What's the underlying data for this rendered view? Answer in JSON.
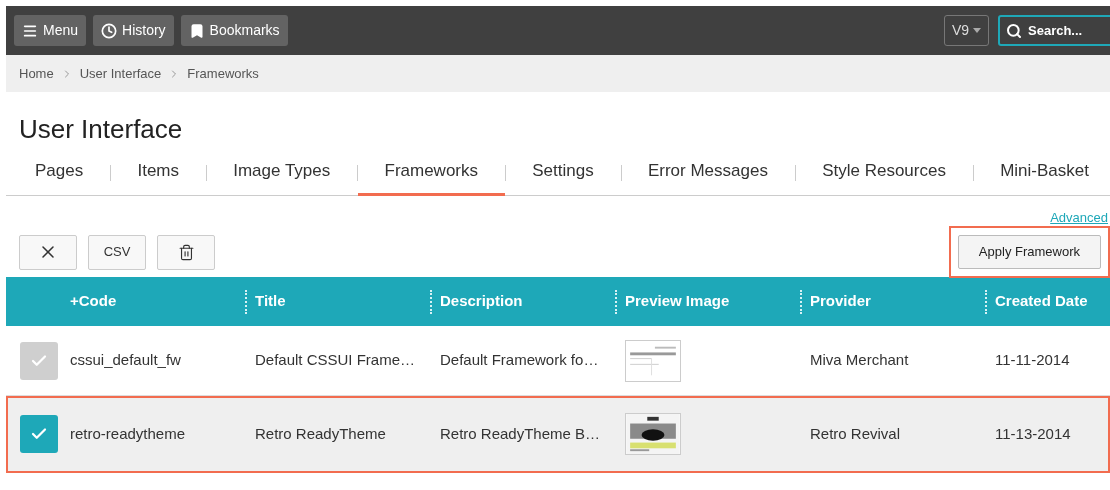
{
  "topbar": {
    "buttons": [
      {
        "kind": "menu",
        "label": "Menu"
      },
      {
        "kind": "history",
        "label": "History"
      },
      {
        "kind": "bookmarks",
        "label": "Bookmarks"
      }
    ],
    "version": "V9",
    "search": {
      "placeholder": "Search..."
    }
  },
  "breadcrumb": [
    "Home",
    "User Interface",
    "Frameworks"
  ],
  "title": "User Interface",
  "tabs": [
    {
      "label": "Pages",
      "selected": false
    },
    {
      "label": "Items",
      "selected": false
    },
    {
      "label": "Image Types",
      "selected": false
    },
    {
      "label": "Frameworks",
      "selected": true
    },
    {
      "label": "Settings",
      "selected": false
    },
    {
      "label": "Error Messages",
      "selected": false
    },
    {
      "label": "Style Resources",
      "selected": false
    },
    {
      "label": "Mini-Basket",
      "selected": false
    }
  ],
  "advanced_link": "Advanced",
  "toolbar": [
    {
      "kind": "close"
    },
    {
      "kind": "text",
      "label": "CSV"
    },
    {
      "kind": "delete"
    }
  ],
  "apply_button": {
    "label": "Apply Framework",
    "highlighted": true
  },
  "table": {
    "columns": [
      "+Code",
      "Title",
      "Description",
      "Preview Image",
      "Provider",
      "Created Date"
    ],
    "rows": [
      {
        "selected": false,
        "highlighted": false,
        "code": "cssui_default_fw",
        "title": "Default CSSUI Frame…",
        "description": "Default Framework fo…",
        "provider": "Miva Merchant",
        "created": "11-11-2014"
      },
      {
        "selected": true,
        "highlighted": true,
        "code": "retro-readytheme",
        "title": "Retro ReadyTheme",
        "description": "Retro ReadyTheme B…",
        "provider": "Retro Revival",
        "created": "11-13-2014"
      }
    ]
  }
}
